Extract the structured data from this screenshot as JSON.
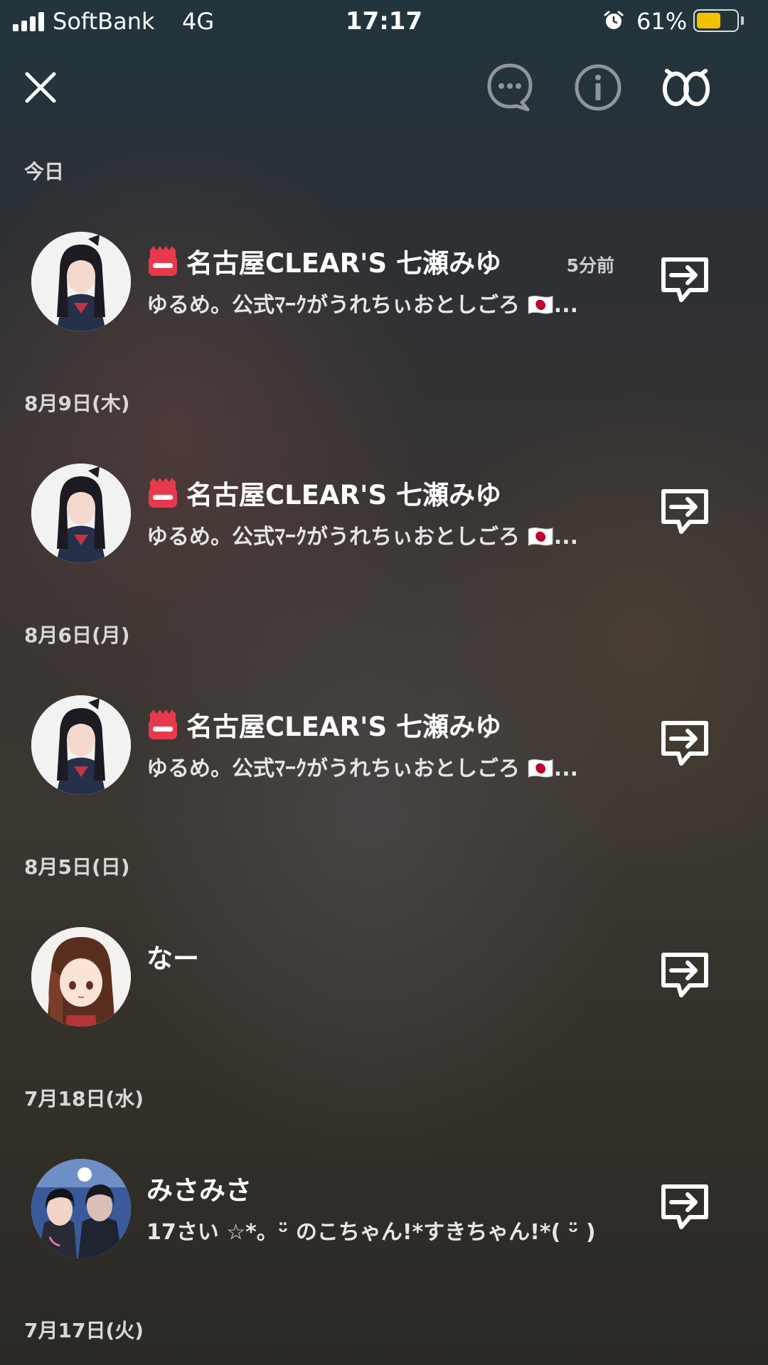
{
  "status_bar": {
    "carrier": "SoftBank",
    "network": "4G",
    "time": "17:17",
    "battery_percent": "61%",
    "battery_level": 0.61,
    "alarm_icon": "alarm-clock-icon"
  },
  "top_bar": {
    "close_icon": "close-icon",
    "chat_icon": "chat-bubble-icon",
    "info_icon": "info-icon",
    "eyes_icon": "eyes-icon"
  },
  "groups": [
    {
      "date": "今日",
      "item": {
        "name": "名古屋CLEAR'S 七瀬みゆ",
        "time_ago": "5分前",
        "message": "ゆるめ。公式ﾏｰｸがうれちぃおとしごろ 🇯🇵...",
        "live_badge": true
      }
    },
    {
      "date": "8月9日(木)",
      "item": {
        "name": "名古屋CLEAR'S 七瀬みゆ",
        "time_ago": "",
        "message": "ゆるめ。公式ﾏｰｸがうれちぃおとしごろ 🇯🇵...",
        "live_badge": true
      }
    },
    {
      "date": "8月6日(月)",
      "item": {
        "name": "名古屋CLEAR'S 七瀬みゆ",
        "time_ago": "",
        "message": "ゆるめ。公式ﾏｰｸがうれちぃおとしごろ 🇯🇵...",
        "live_badge": true
      }
    },
    {
      "date": "8月5日(日)",
      "item": {
        "name": "なー",
        "time_ago": "",
        "message": "",
        "live_badge": false
      }
    },
    {
      "date": "7月18日(水)",
      "item": {
        "name": "みさみさ",
        "time_ago": "",
        "message": "17さい ☆*。ᵕ̈  のこちゃん!*すきちゃん!*( ᵕ̈ )",
        "live_badge": false
      }
    },
    {
      "date": "7月17日(火)"
    }
  ],
  "colors": {
    "battery_fill": "#f2c200",
    "live_badge": "#e8394c"
  }
}
